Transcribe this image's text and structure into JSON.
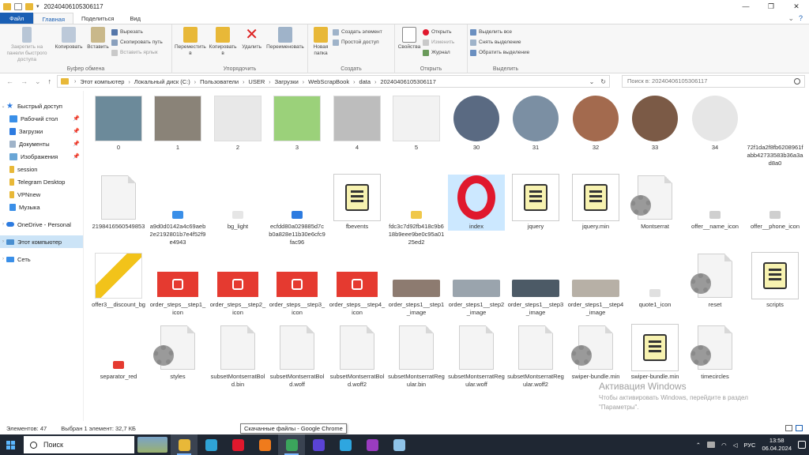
{
  "window": {
    "title": "20240406105306117",
    "controls": [
      "—",
      "❐",
      "✕"
    ]
  },
  "ribbon_tabs": [
    "Файл",
    "Главная",
    "Поделиться",
    "Вид"
  ],
  "ribbon": {
    "clipboard": {
      "pin": "Закрепить на панели быстрого доступа",
      "copy": "Копировать",
      "paste": "Вставить",
      "cut": "Вырезать",
      "copy_path": "Скопировать путь",
      "paste_shortcut": "Вставить ярлык",
      "label": "Буфер обмена"
    },
    "organize": {
      "move_to": "Переместить в",
      "copy_to": "Копировать в",
      "delete": "Удалить",
      "rename": "Переименовать",
      "label": "Упорядочить"
    },
    "create": {
      "new_folder": "Новая папка",
      "new_item": "Создать элемент",
      "easy_access": "Простой доступ",
      "label": "Создать"
    },
    "open": {
      "properties": "Свойства",
      "open": "Открыть",
      "edit": "Изменить",
      "history": "Журнал",
      "label": "Открыть"
    },
    "select": {
      "select_all": "Выделить все",
      "select_none": "Снять выделение",
      "invert": "Обратить выделение",
      "label": "Выделить"
    }
  },
  "address": {
    "crumbs": [
      "Этот компьютер",
      "Локальный диск (C:)",
      "Пользователи",
      "USER",
      "Загрузки",
      "WebScrapBook",
      "data",
      "20240406105306117"
    ],
    "search_placeholder": "Поиск в: 20240406105306117"
  },
  "nav": {
    "quick_access": "Быстрый доступ",
    "pinned": [
      "Рабочий стол",
      "Загрузки",
      "Документы",
      "Изображения"
    ],
    "folders": [
      "session",
      "Telegram Desktop",
      "VPNnew",
      "Музыка"
    ],
    "onedrive": "OneDrive - Personal",
    "this_pc": "Этот компьютер",
    "network": "Сеть"
  },
  "files": [
    {
      "name": "0",
      "kind": "photo",
      "color": "#6c8a9a"
    },
    {
      "name": "1",
      "kind": "photo",
      "color": "#8a8378"
    },
    {
      "name": "2",
      "kind": "photo",
      "color": "#e8e8e8"
    },
    {
      "name": "3",
      "kind": "photo",
      "color": "#9bd17a"
    },
    {
      "name": "4",
      "kind": "photo",
      "color": "#bdbdbd"
    },
    {
      "name": "5",
      "kind": "photo",
      "color": "#f2f2f2"
    },
    {
      "name": "30",
      "kind": "circle",
      "color": "#5a6a82"
    },
    {
      "name": "31",
      "kind": "circle",
      "color": "#7b8fa3"
    },
    {
      "name": "32",
      "kind": "circle",
      "color": "#a36a4e"
    },
    {
      "name": "33",
      "kind": "circle",
      "color": "#7b5a46"
    },
    {
      "name": "34",
      "kind": "circle",
      "color": "#e6e6e6"
    },
    {
      "name": "72f1da2f8fb6208961fabb42733583b36a3ad8a0",
      "kind": "blank"
    },
    {
      "name": "2198416560549853",
      "kind": "page"
    },
    {
      "name": "a9d0d0142a4c69aeb2e2192801b7e4f52f9e4943",
      "kind": "tiny",
      "color": "#3a8fe8"
    },
    {
      "name": "bg_light",
      "kind": "tiny",
      "color": "#e6e6e6"
    },
    {
      "name": "ecfdd80a029885d7cb0a828e11b30e6cfc9fac96",
      "kind": "tiny",
      "color": "#2d7be0"
    },
    {
      "name": "fbevents",
      "kind": "script"
    },
    {
      "name": "fdc3c7d92fb418c9b618b9eee9be0c95a0125ed2",
      "kind": "tiny",
      "color": "#f0c84a"
    },
    {
      "name": "index",
      "kind": "opera",
      "selected": true
    },
    {
      "name": "jquery",
      "kind": "script"
    },
    {
      "name": "jquery.min",
      "kind": "script"
    },
    {
      "name": "Montserrat",
      "kind": "gearpage"
    },
    {
      "name": "offer__name_icon",
      "kind": "tiny",
      "color": "#cfcfcf"
    },
    {
      "name": "offer__phone_icon",
      "kind": "tiny",
      "color": "#cfcfcf"
    },
    {
      "name": "offer3__discount_bg",
      "kind": "yellow"
    },
    {
      "name": "order_steps__step1_icon",
      "kind": "red"
    },
    {
      "name": "order_steps__step2_icon",
      "kind": "red"
    },
    {
      "name": "order_steps__step3_icon",
      "kind": "red"
    },
    {
      "name": "order_steps__step4_icon",
      "kind": "red"
    },
    {
      "name": "order_steps1__step1_image",
      "kind": "strip",
      "color": "#8d7b70"
    },
    {
      "name": "order_steps1__step2_image",
      "kind": "strip",
      "color": "#9aa4ad"
    },
    {
      "name": "order_steps1__step3_image",
      "kind": "strip",
      "color": "#4c5a66"
    },
    {
      "name": "order_steps1__step4_image",
      "kind": "strip",
      "color": "#b7b0a6"
    },
    {
      "name": "quote1_icon",
      "kind": "tiny",
      "color": "#e0e0e0"
    },
    {
      "name": "reset",
      "kind": "gearpage"
    },
    {
      "name": "scripts",
      "kind": "script"
    },
    {
      "name": "separator_red",
      "kind": "tiny",
      "color": "#e53a30"
    },
    {
      "name": "styles",
      "kind": "gearpage"
    },
    {
      "name": "subsetMontserratBold.bin",
      "kind": "page"
    },
    {
      "name": "subsetMontserratBold.woff",
      "kind": "page"
    },
    {
      "name": "subsetMontserratBold.woff2",
      "kind": "page"
    },
    {
      "name": "subsetMontserratRegular.bin",
      "kind": "page"
    },
    {
      "name": "subsetMontserratRegular.woff",
      "kind": "page"
    },
    {
      "name": "subsetMontserratRegular.woff2",
      "kind": "page"
    },
    {
      "name": "swiper-bundle.min",
      "kind": "gearpage"
    },
    {
      "name": "swiper-bundle.min",
      "kind": "script"
    },
    {
      "name": "timecircles",
      "kind": "gearpage"
    }
  ],
  "status": {
    "count": "Элементов: 47",
    "selection": "Выбран 1 элемент: 32,7 КБ"
  },
  "tooltip": "Скачанные файлы - Google Chrome",
  "activation": {
    "title": "Активация Windows",
    "text": "Чтобы активировать Windows, перейдите в раздел \"Параметры\"."
  },
  "taskbar": {
    "search": "Поиск",
    "lang": "РУС",
    "time": "13:58",
    "date": "06.04.2024",
    "icons": [
      {
        "name": "taskbar-explorer-icon",
        "color": "#e8b838",
        "active": true
      },
      {
        "name": "taskbar-edge-icon",
        "color": "#2fa3d6"
      },
      {
        "name": "taskbar-opera-icon",
        "color": "#e0182d"
      },
      {
        "name": "taskbar-firefox-icon",
        "color": "#f07b1c"
      },
      {
        "name": "taskbar-chrome-icon",
        "color": "#3ba55c",
        "active": true
      },
      {
        "name": "taskbar-app-icon",
        "color": "#5a43d6"
      },
      {
        "name": "taskbar-telegram-icon",
        "color": "#2ea6e0"
      },
      {
        "name": "taskbar-adm-icon",
        "color": "#9a3cc0"
      },
      {
        "name": "taskbar-notepad-icon",
        "color": "#8fc3e8"
      }
    ]
  }
}
